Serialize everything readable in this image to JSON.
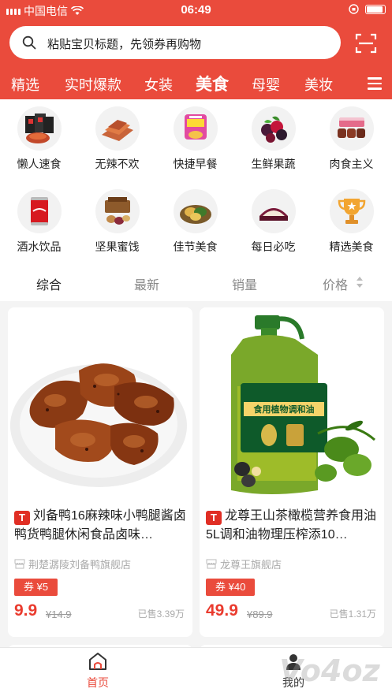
{
  "status_bar": {
    "carrier": "中国电信",
    "time": "06:49"
  },
  "search": {
    "placeholder": "粘贴宝贝标题，先领券再购物"
  },
  "tabs": [
    {
      "label": "精选"
    },
    {
      "label": "实时爆款"
    },
    {
      "label": "女装"
    },
    {
      "label": "美食"
    },
    {
      "label": "母婴"
    },
    {
      "label": "美妆"
    }
  ],
  "categories": [
    {
      "label": "懒人速食",
      "icon": "instant-food-icon"
    },
    {
      "label": "无辣不欢",
      "icon": "spicy-food-icon"
    },
    {
      "label": "快捷早餐",
      "icon": "breakfast-icon"
    },
    {
      "label": "生鲜果蔬",
      "icon": "fresh-fruit-icon"
    },
    {
      "label": "肉食主义",
      "icon": "meat-icon"
    },
    {
      "label": "酒水饮品",
      "icon": "drinks-icon"
    },
    {
      "label": "坚果蜜饯",
      "icon": "nuts-icon"
    },
    {
      "label": "佳节美食",
      "icon": "festival-food-icon"
    },
    {
      "label": "每日必吃",
      "icon": "daily-snack-icon"
    },
    {
      "label": "精选美食",
      "icon": "trophy-icon"
    }
  ],
  "sort": [
    {
      "label": "综合"
    },
    {
      "label": "最新"
    },
    {
      "label": "销量"
    },
    {
      "label": "价格"
    }
  ],
  "products": [
    {
      "badge": "T",
      "title": "刘备鸭16麻辣味小鸭腿酱卤鸭货鸭腿休闲食品卤味…",
      "shop": "荆楚潺陵刘备鸭旗舰店",
      "coupon": "券 ¥5",
      "price": "9.9",
      "original_price": "¥14.9",
      "sold": "已售3.39万"
    },
    {
      "badge": "T",
      "title": "龙尊王山茶橄榄营养食用油5L调和油物理压榨添10…",
      "shop": "龙尊王旗舰店",
      "coupon": "券 ¥40",
      "price": "49.9",
      "original_price": "¥89.9",
      "sold": "已售1.31万",
      "bottle_label": "食用植物调和油"
    }
  ],
  "bottom_nav": [
    {
      "label": "首页"
    },
    {
      "label": "我的"
    }
  ],
  "watermark": "Vo4oz",
  "colors": {
    "brand": "#ea4b3c",
    "price": "#ea3b2e"
  }
}
